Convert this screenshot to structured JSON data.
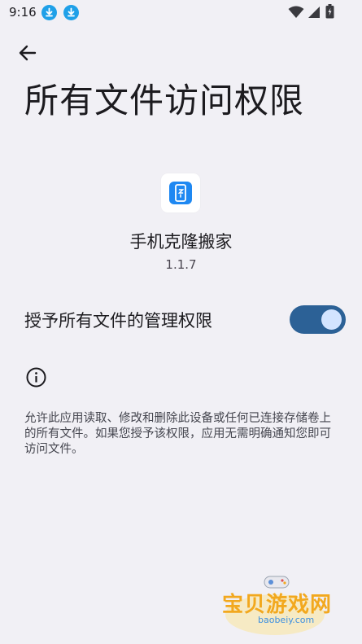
{
  "status_bar": {
    "time": "9:16"
  },
  "header": {
    "title": "所有文件访问权限"
  },
  "app": {
    "name": "手机克隆搬家",
    "version": "1.1.7"
  },
  "permission": {
    "label": "授予所有文件的管理权限",
    "enabled": true
  },
  "info": {
    "text": "允许此应用读取、修改和删除此设备或任何已连接存储卷上的所有文件。如果您授予该权限，应用无需明确通知您即可访问文件。"
  },
  "watermark": {
    "text": "宝贝游戏网",
    "url": "baobeiy.com"
  },
  "colors": {
    "background": "#f1f0f5",
    "toggle_track": "#2c6196",
    "toggle_knob": "#d3e4ff",
    "app_icon": "#1e88f2",
    "download_badge": "#1fa0e8"
  },
  "icons": [
    "download-icon",
    "download-icon",
    "wifi-icon",
    "cell-signal-icon",
    "battery-icon",
    "back-arrow-icon",
    "app-icon",
    "info-icon"
  ]
}
